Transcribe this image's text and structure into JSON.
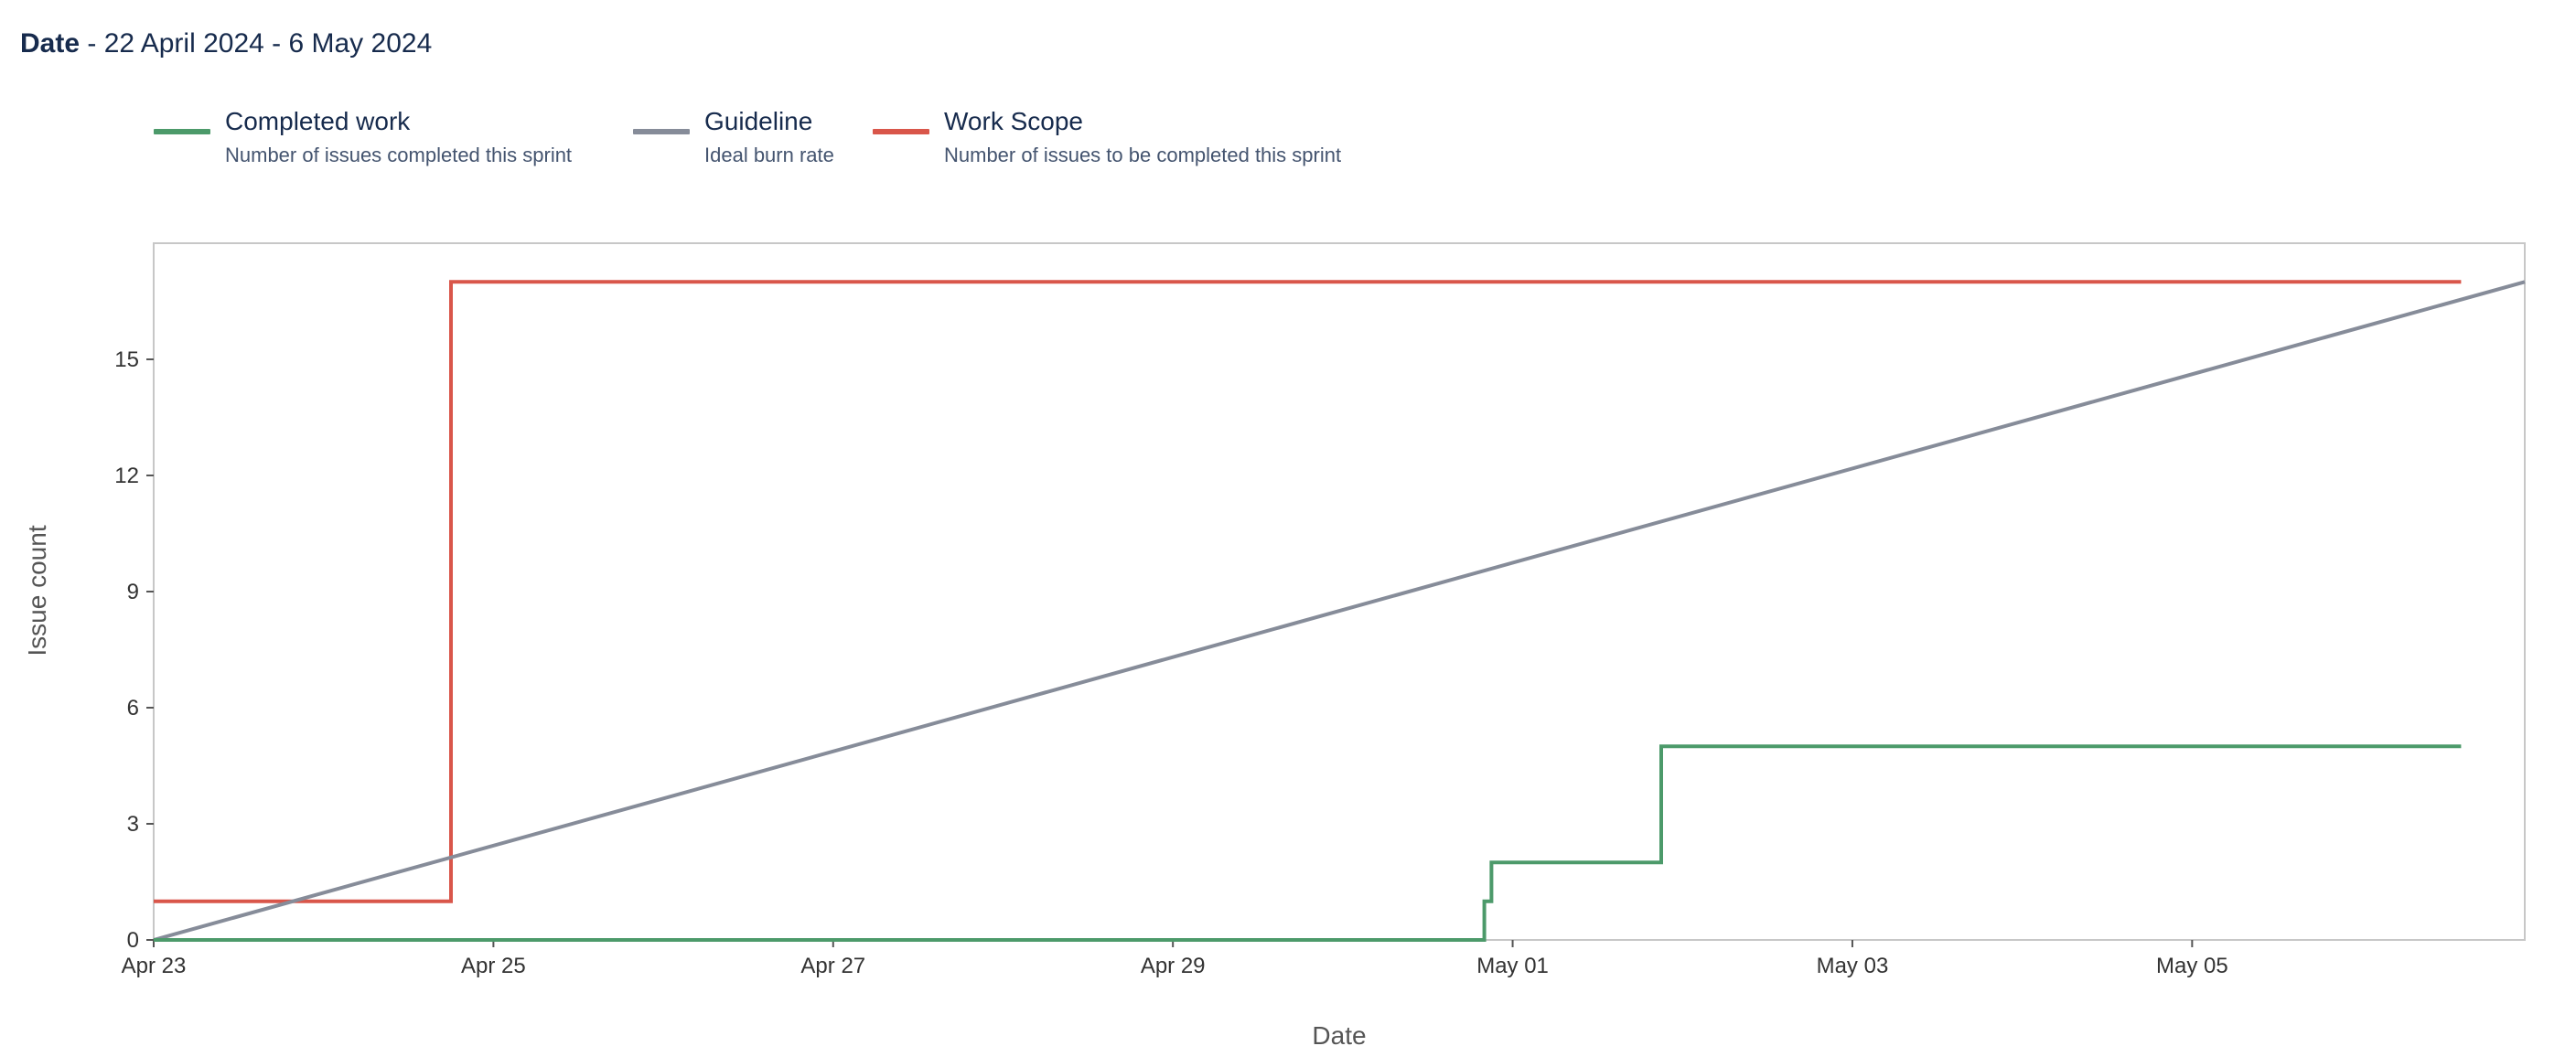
{
  "header": {
    "date_label": "Date",
    "date_range": " - 22 April 2024 - 6 May 2024"
  },
  "legend": [
    {
      "title": "Completed work",
      "description": "Number of issues completed this sprint",
      "color": "#4c9a6a"
    },
    {
      "title": "Guideline",
      "description": "Ideal burn rate",
      "color": "#868c99"
    },
    {
      "title": "Work Scope",
      "description": "Number of issues to be completed this sprint",
      "color": "#d9564a"
    }
  ],
  "chart_data": {
    "type": "line",
    "xlabel": "Date",
    "ylabel": "Issue count",
    "x_ticks": [
      "Apr 23",
      "Apr 25",
      "Apr 27",
      "Apr 29",
      "May 01",
      "May 03",
      "May 05"
    ],
    "y_ticks": [
      0,
      3,
      6,
      9,
      12,
      15
    ],
    "xlim": [
      "2024-04-23 00:00",
      "2024-05-06 23:00"
    ],
    "ylim": [
      0,
      18
    ],
    "grid": false,
    "series": [
      {
        "name": "Work Scope",
        "color": "#d9564a",
        "step": true,
        "points": [
          [
            "2024-04-23 00:00",
            1
          ],
          [
            "2024-04-24 18:00",
            1
          ],
          [
            "2024-04-24 18:00",
            17
          ],
          [
            "2024-05-06 14:00",
            17
          ]
        ]
      },
      {
        "name": "Guideline",
        "color": "#868c99",
        "step": false,
        "points": [
          [
            "2024-04-23 00:00",
            0
          ],
          [
            "2024-05-06 23:00",
            17
          ]
        ]
      },
      {
        "name": "Completed work",
        "color": "#4c9a6a",
        "step": true,
        "points": [
          [
            "2024-04-23 00:00",
            0
          ],
          [
            "2024-04-30 20:00",
            0
          ],
          [
            "2024-04-30 20:00",
            1
          ],
          [
            "2024-04-30 21:00",
            1
          ],
          [
            "2024-04-30 21:00",
            2
          ],
          [
            "2024-05-01 21:00",
            2
          ],
          [
            "2024-05-01 21:00",
            5
          ],
          [
            "2024-05-06 14:00",
            5
          ]
        ]
      }
    ]
  }
}
